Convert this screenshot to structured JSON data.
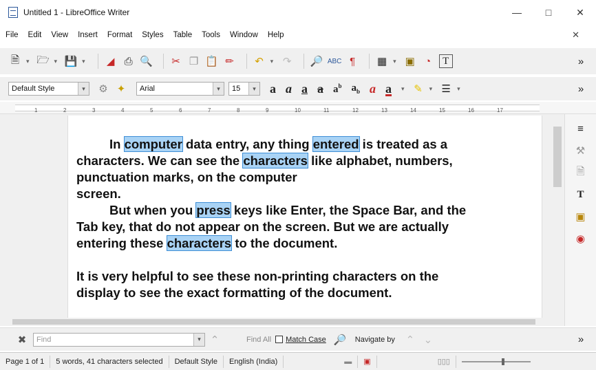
{
  "window": {
    "title": "Untitled 1 - LibreOffice Writer"
  },
  "menu": [
    "File",
    "Edit",
    "View",
    "Insert",
    "Format",
    "Styles",
    "Table",
    "Tools",
    "Window",
    "Help"
  ],
  "formatting": {
    "paragraph_style": "Default Style",
    "font_name": "Arial",
    "font_size": "15"
  },
  "document": {
    "paragraphs": [
      [
        {
          "t": "In "
        },
        {
          "t": "computer",
          "sel": true
        },
        {
          "t": " data entry, any thing "
        },
        {
          "t": "entered",
          "sel": true
        },
        {
          "t": " is treated as a"
        }
      ],
      [
        {
          "t": "characters. We can see the "
        },
        {
          "t": "characters",
          "sel": true
        },
        {
          "t": " like alphabet, numbers,"
        }
      ],
      [
        {
          "t": "punctuation marks, on the computer"
        }
      ],
      [
        {
          "t": "screen."
        }
      ],
      [
        {
          "t": "But when you "
        },
        {
          "t": "press",
          "sel": true
        },
        {
          "t": " keys like Enter, the Space Bar, and the"
        }
      ],
      [
        {
          "t": "Tab key, that do not appear on the screen. But we are actually"
        }
      ],
      [
        {
          "t": "entering these "
        },
        {
          "t": "characters",
          "sel": true
        },
        {
          "t": " to the document."
        }
      ],
      [
        {
          "t": ""
        }
      ],
      [
        {
          "t": "It is very helpful to see these non-printing characters on the"
        }
      ],
      [
        {
          "t": "display to see the exact formatting of the document."
        }
      ]
    ],
    "indented_lines": [
      0,
      4
    ]
  },
  "findbar": {
    "placeholder": "Find",
    "find_all": "Find All",
    "match_case": "Match Case",
    "navigate_by": "Navigate by"
  },
  "statusbar": {
    "page": "Page 1 of 1",
    "selection": "5 words, 41 characters selected",
    "page_style": "Default Style",
    "language": "English (India)"
  },
  "ruler_numbers": [
    "1",
    "2",
    "3",
    "4",
    "5",
    "6",
    "7",
    "8",
    "9",
    "10",
    "11",
    "12",
    "13",
    "14",
    "15",
    "16",
    "17"
  ],
  "colors": {
    "selection": "#a9d3f5",
    "selection_border": "#3d8ed6"
  }
}
